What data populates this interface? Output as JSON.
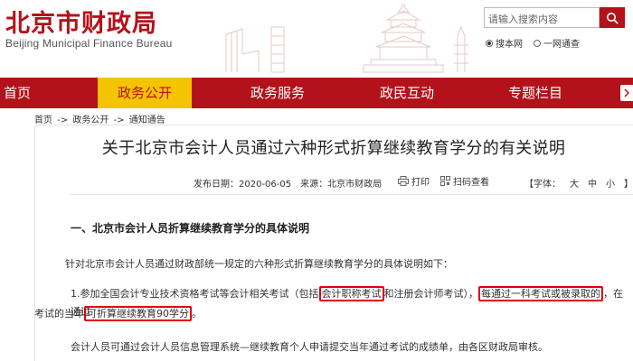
{
  "header": {
    "logo_cn": "北京市财政局",
    "logo_en": "Beijing Municipal Finance Bureau",
    "search_placeholder": "请输入搜索内容",
    "radio_site": "搜本网",
    "radio_portal": "一网通查"
  },
  "nav": {
    "items": [
      "首页",
      "政务公开",
      "政务服务",
      "政民互动",
      "专题栏目"
    ],
    "active_index": 1
  },
  "breadcrumb": [
    "首页",
    "政务公开",
    "通知通告"
  ],
  "breadcrumb_sep": "->",
  "article": {
    "title": "关于北京市会计人员通过六种形式折算继续教育学分的有关说明",
    "date_label": "发布日期：2020-06-05",
    "source_label": "来源：北京市财政局",
    "print_label": "打印",
    "qr_label": "扫码查看",
    "fontsize_label": "【字体：",
    "fontsize_large": "大",
    "fontsize_medium": "中",
    "fontsize_small": "小",
    "fontsize_end": "】",
    "section1": "一、北京市会计人员折算继续教育学分的具体说明",
    "para1": "针对北京市会计人员通过财政部统一规定的六种形式折算继续教育学分的具体说明如下：",
    "para2_a": "1.参加全国会计专业技术资格考试等会计相关考试（包括",
    "para2_b": "会计职称考试",
    "para2_c": "和注册会计师考试），",
    "para2_d": "每通过一科考试或被录取的",
    "para2_e": "，在通过",
    "para2_f": "考试的当年",
    "para2_g": "可折算继续教育90学分",
    "para2_h": "。",
    "para3": "会计人员可通过会计人员信息管理系统—继续教育个人申请提交当年通过考试的成绩单，由各区财政局审核。"
  },
  "colors": {
    "brand_red": "#b3121a",
    "nav_active": "#f5c400",
    "highlight_box": "#e0000d"
  }
}
